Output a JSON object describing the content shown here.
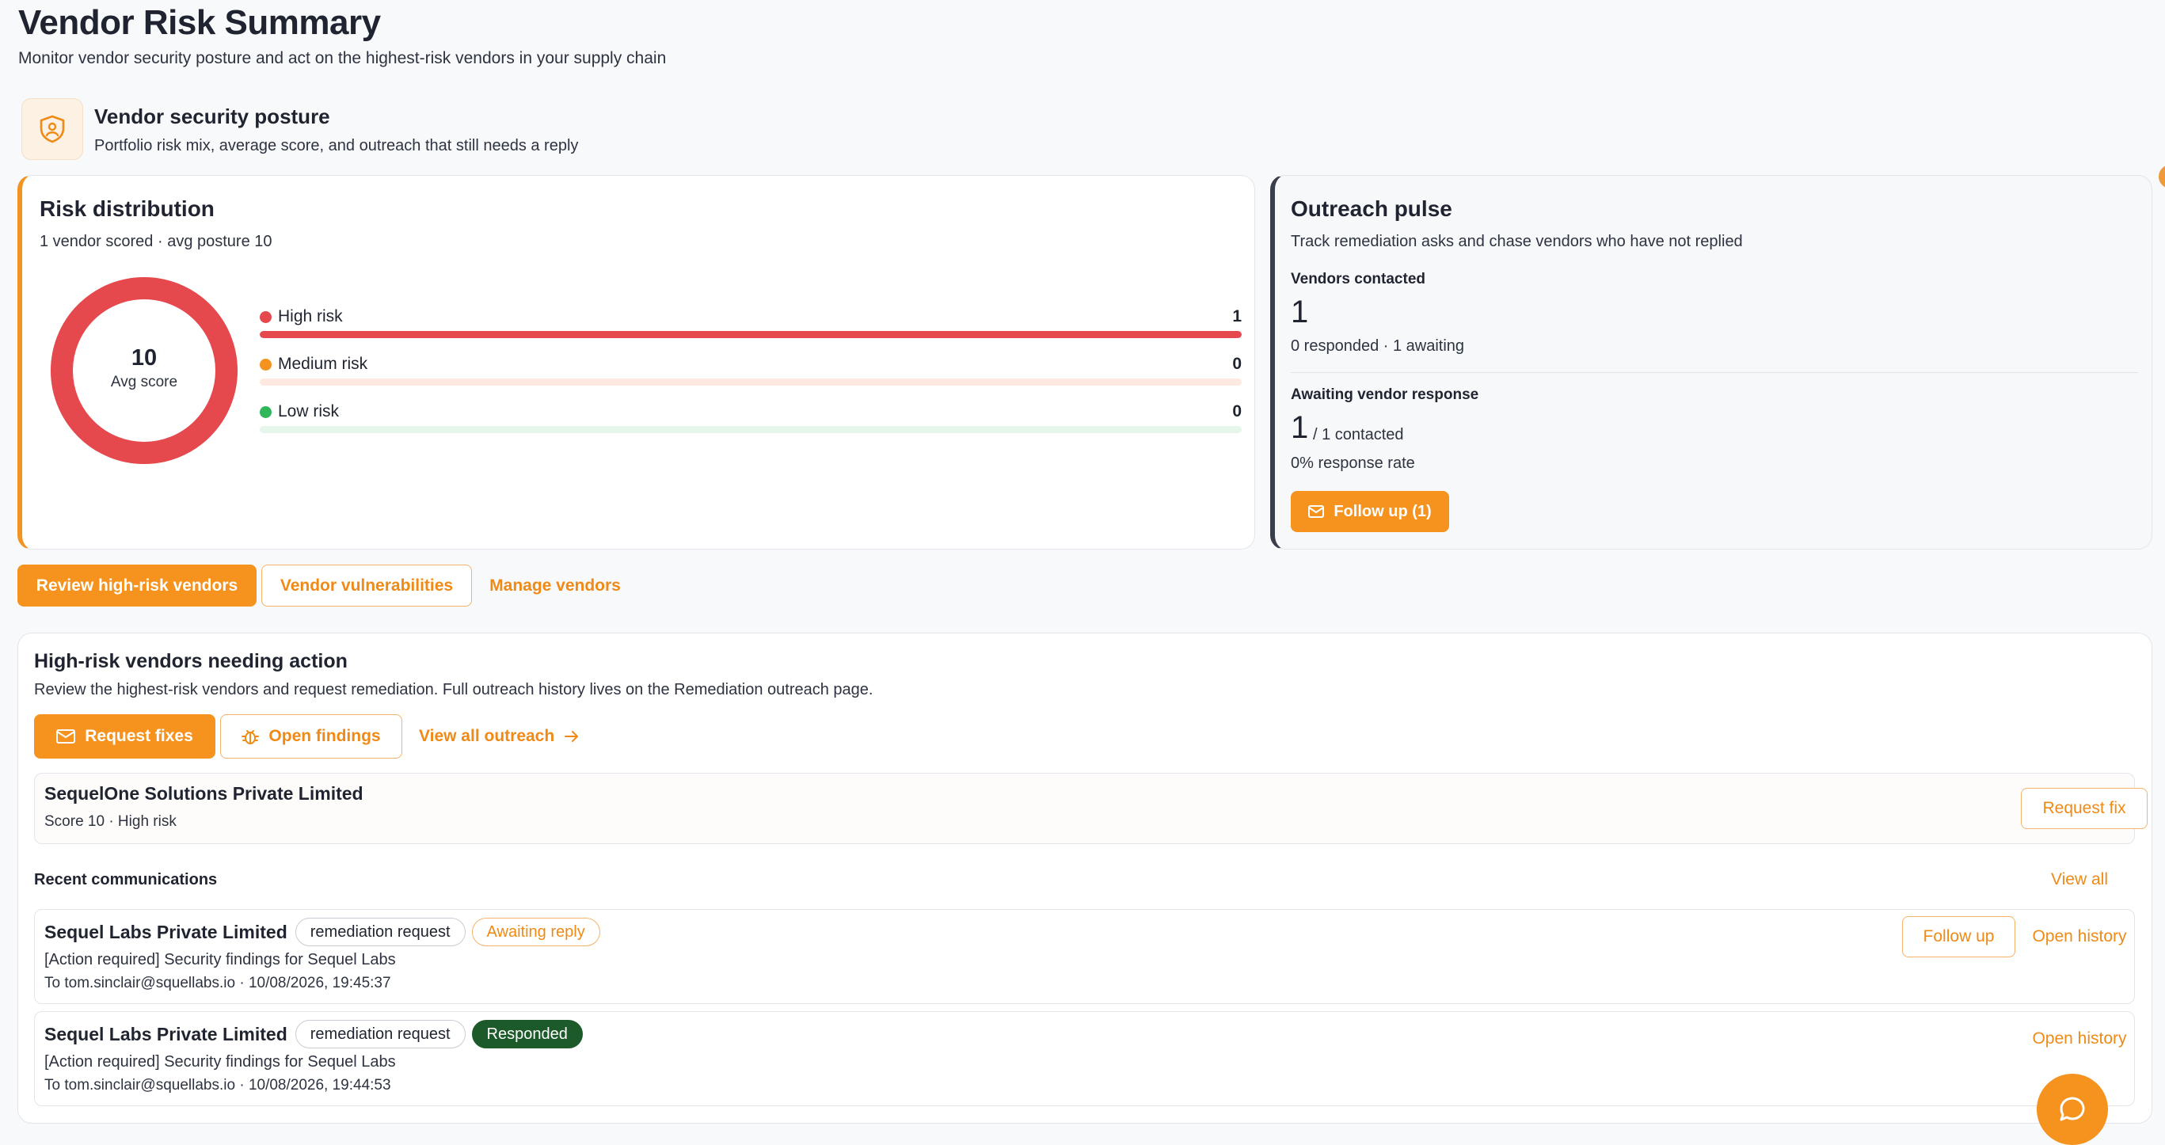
{
  "page": {
    "title": "Vendor Risk Summary",
    "subtitle": "Monitor vendor security posture and act on the highest-risk vendors in your supply chain"
  },
  "section": {
    "icon": "shield-user-icon",
    "title": "Vendor security posture",
    "subtitle": "Portfolio risk mix, average score, and outreach that still needs a reply"
  },
  "risk_card": {
    "title": "Risk distribution",
    "subtitle": "1 vendor scored · avg posture 10",
    "donut_value": "10",
    "donut_label": "Avg score",
    "donut_fill_fraction": 1.0,
    "rows": [
      {
        "label": "High risk",
        "count": "1",
        "color": "#e5484d",
        "track": "#fbe3e4",
        "fraction": 1.0
      },
      {
        "label": "Medium risk",
        "count": "0",
        "color": "#f5931e",
        "track": "#fde9df",
        "fraction": 0.0
      },
      {
        "label": "Low risk",
        "count": "0",
        "color": "#2fb85a",
        "track": "#e6f6ea",
        "fraction": 0.0
      }
    ]
  },
  "pulse_card": {
    "title": "Outreach pulse",
    "subtitle": "Track remediation asks and chase vendors who have not replied",
    "contacted_label": "Vendors contacted",
    "contacted_value": "1",
    "contacted_detail": "0 responded · 1 awaiting",
    "awaiting_label": "Awaiting vendor response",
    "awaiting_value": "1",
    "awaiting_suffix": "/ 1 contacted",
    "response_rate": "0% response rate",
    "follow_up_label": "Follow up (1)"
  },
  "action_bar": {
    "review_label": "Review high-risk vendors",
    "vulns_label": "Vendor vulnerabilities",
    "manage_label": "Manage vendors"
  },
  "actions_card": {
    "title": "High-risk vendors needing action",
    "subtitle": "Review the highest-risk vendors and request remediation. Full outreach history lives on the Remediation outreach page.",
    "request_fixes_label": "Request fixes",
    "open_findings_label": "Open findings",
    "view_outreach_label": "View all outreach",
    "vendor": {
      "name": "SequelOne Solutions Private Limited",
      "meta": "Score 10 · High risk",
      "action_label": "Request fix"
    },
    "recent_title": "Recent communications",
    "view_all_label": "View all",
    "communications": [
      {
        "vendor": "Sequel Labs Private Limited",
        "type": "remediation request",
        "status": "Awaiting reply",
        "subject": "[Action required] Security findings for Sequel Labs",
        "to": "To tom.sinclair@squellabs.io · 10/08/2026, 19:45:37",
        "follow_up_label": "Follow up",
        "history_label": "Open history"
      },
      {
        "vendor": "Sequel Labs Private Limited",
        "type": "remediation request",
        "status": "Responded",
        "subject": "[Action required] Security findings for Sequel Labs",
        "to": "To tom.sinclair@squellabs.io · 10/08/2026, 19:44:53",
        "history_label": "Open history"
      }
    ]
  },
  "colors": {
    "accent": "#f5931e",
    "high": "#e5484d",
    "medium": "#f5931e",
    "low": "#2fb85a",
    "responded": "#1d5a2a"
  }
}
